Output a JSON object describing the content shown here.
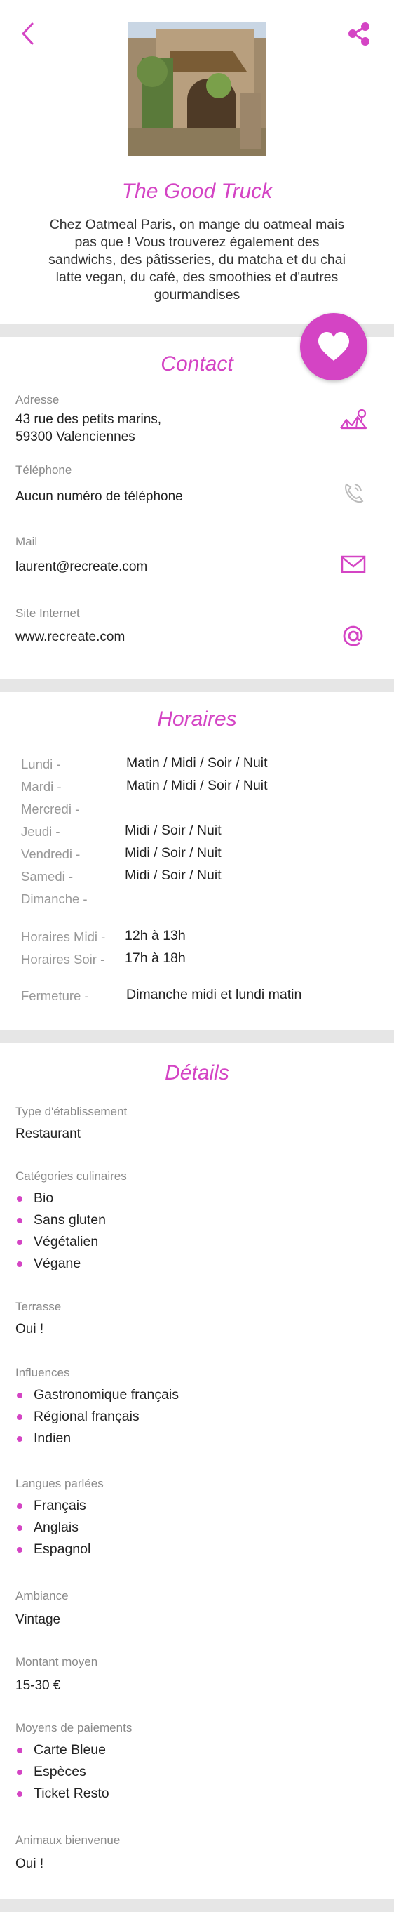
{
  "header": {
    "back_icon": "chevron-left-icon",
    "share_icon": "share-icon",
    "photo": "stone-house-photo",
    "title": "The Good Truck",
    "description": "Chez Oatmeal Paris, on mange du oatmeal mais pas que ! Vous trouverez également des sandwichs, des pâtisseries, du matcha et du chai latte vegan, du café, des smoothies et d'autres gourmandises"
  },
  "favorite": {
    "icon": "heart-icon"
  },
  "contact": {
    "title": "Contact",
    "address_label": "Adresse",
    "address_line1": "43 rue des petits marins,",
    "address_line2": "59300 Valenciennes",
    "phone_label": "Téléphone",
    "phone_value": "Aucun numéro de téléphone",
    "mail_label": "Mail",
    "mail_value": "laurent@recreate.com",
    "site_label": "Site Internet",
    "site_value": "www.recreate.com"
  },
  "horaires": {
    "title": "Horaires",
    "days": [
      {
        "day": "Lundi  -",
        "value": "Matin / Midi / Soir / Nuit"
      },
      {
        "day": "Mardi  -",
        "value": "Matin / Midi / Soir / Nuit"
      },
      {
        "day": "Mercredi  -",
        "value": ""
      },
      {
        "day": "Jeudi  -",
        "value": "Midi / Soir / Nuit"
      },
      {
        "day": "Vendredi  -",
        "value": "Midi / Soir / Nuit"
      },
      {
        "day": "Samedi  -",
        "value": "Midi / Soir / Nuit"
      },
      {
        "day": "Dimanche  -",
        "value": ""
      }
    ],
    "midi_label": "Horaires Midi -",
    "midi_value": "12h à 13h",
    "soir_label": "Horaires Soir -",
    "soir_value": "17h à 18h",
    "fermeture_label": "Fermeture -",
    "fermeture_value": "Dimanche midi et lundi matin"
  },
  "details": {
    "title": "Détails",
    "type_label": "Type d'établissement",
    "type_value": "Restaurant",
    "categories_label": "Catégories culinaires",
    "categories": [
      "Bio",
      "Sans gluten",
      "Végétalien",
      "Végane"
    ],
    "terrasse_label": "Terrasse",
    "terrasse_value": "Oui !",
    "influences_label": "Influences",
    "influences": [
      "Gastronomique français",
      "Régional français",
      "Indien"
    ],
    "langues_label": "Langues parlées",
    "langues": [
      "Français",
      "Anglais",
      "Espagnol"
    ],
    "ambiance_label": "Ambiance",
    "ambiance_value": "Vintage",
    "montant_label": "Montant moyen",
    "montant_value": "15-30 €",
    "paiements_label": "Moyens de paiements",
    "paiements": [
      "Carte Bleue",
      "Espèces",
      "Ticket Resto"
    ],
    "animaux_label": "Animaux bienvenue",
    "animaux_value": "Oui !"
  },
  "colors": {
    "accent": "#d444c4",
    "separator": "#e6e6e6",
    "label": "#8a8a8a"
  }
}
